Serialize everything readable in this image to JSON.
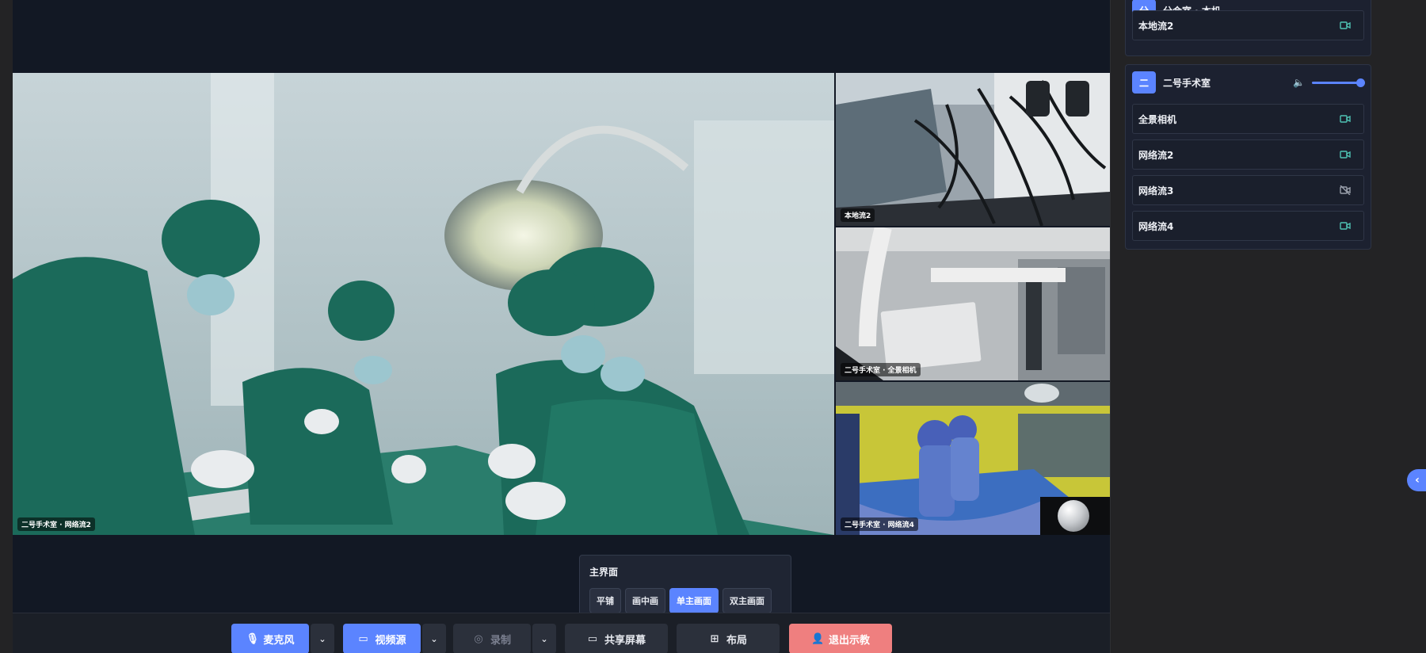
{
  "videos": {
    "main_caption": "二号手术室 · 网络流2",
    "side": [
      {
        "caption": "本地流2"
      },
      {
        "caption": "二号手术室 · 全景相机"
      },
      {
        "caption": "二号手术室 · 网络流4"
      }
    ]
  },
  "layout_popover": {
    "title": "主界面",
    "options": [
      "平铺",
      "画中画",
      "单主画面",
      "双主画面"
    ],
    "selected": "单主画面"
  },
  "toolbar": {
    "mic": "麦克风",
    "video_source": "视频源",
    "record": "录制",
    "share_screen": "共享屏幕",
    "layout": "布局",
    "exit": "退出示教"
  },
  "panel": {
    "group1": {
      "badge": "分",
      "name": "分会室 · 本机",
      "streams": [
        {
          "label": "本地流2",
          "enabled": true
        }
      ]
    },
    "group2": {
      "badge": "二",
      "name": "二号手术室",
      "volume": 0.95,
      "streams": [
        {
          "label": "全景相机",
          "enabled": true
        },
        {
          "label": "网络流2",
          "enabled": true
        },
        {
          "label": "网络流3",
          "enabled": false
        },
        {
          "label": "网络流4",
          "enabled": true
        }
      ]
    }
  },
  "colors": {
    "accent": "#5b84ff",
    "danger": "#ef7f7f",
    "stage_bg": "#121824",
    "teal_icon": "#4fc3b4"
  }
}
